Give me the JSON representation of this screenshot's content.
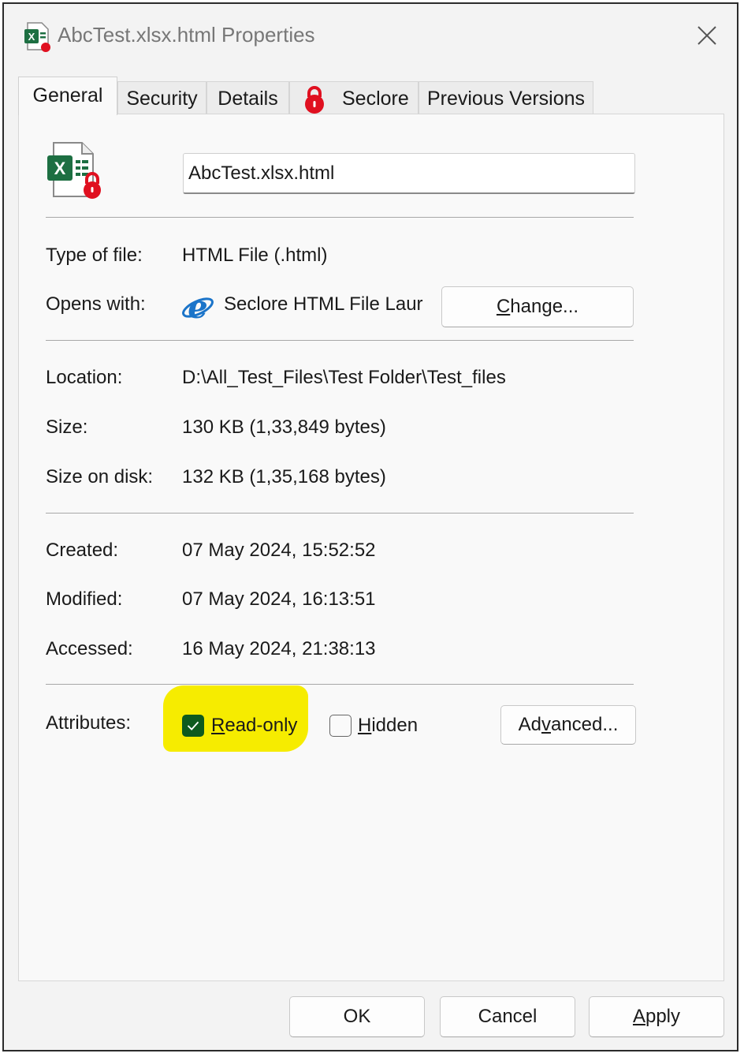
{
  "window": {
    "title": "AbcTest.xlsx.html Properties"
  },
  "tabs": [
    {
      "label": "General",
      "icon": ""
    },
    {
      "label": "Security",
      "icon": ""
    },
    {
      "label": "Details",
      "icon": ""
    },
    {
      "label": "Seclore",
      "icon": "red-lock-icon"
    },
    {
      "label": "Previous Versions",
      "icon": ""
    }
  ],
  "general": {
    "file_name": "AbcTest.xlsx.html",
    "type_label": "Type of file:",
    "type_value": "HTML File (.html)",
    "opens_label": "Opens with:",
    "opens_value": "Seclore HTML File Laur",
    "change_button": {
      "prefix": "",
      "mnemonic": "C",
      "suffix": "hange..."
    },
    "location_label": "Location:",
    "location_value": "D:\\All_Test_Files\\Test Folder\\Test_files",
    "size_label": "Size:",
    "size_value": "130 KB (1,33,849 bytes)",
    "size_on_disk_label": "Size on disk:",
    "size_on_disk_value": "132 KB (1,35,168 bytes)",
    "created_label": "Created:",
    "created_value": "07 May 2024, 15:52:52",
    "modified_label": "Modified:",
    "modified_value": "07 May 2024, 16:13:51",
    "accessed_label": "Accessed:",
    "accessed_value": "16 May 2024, 21:38:13",
    "attributes_label": "Attributes:",
    "readonly": {
      "prefix": "",
      "mnemonic": "R",
      "suffix": "ead-only",
      "checked": true
    },
    "hidden": {
      "prefix": "",
      "mnemonic": "H",
      "suffix": "idden",
      "checked": false
    },
    "advanced_button": {
      "prefix": "Ad",
      "mnemonic": "v",
      "suffix": "anced..."
    }
  },
  "footer": {
    "ok": "OK",
    "cancel": "Cancel",
    "apply": {
      "prefix": "",
      "mnemonic": "A",
      "suffix": "pply"
    }
  },
  "colors": {
    "highlight": "#f6ec00",
    "checkbox_checked": "#0e5a1e",
    "excel_green": "#1d6f42",
    "lock_red": "#e01020"
  }
}
